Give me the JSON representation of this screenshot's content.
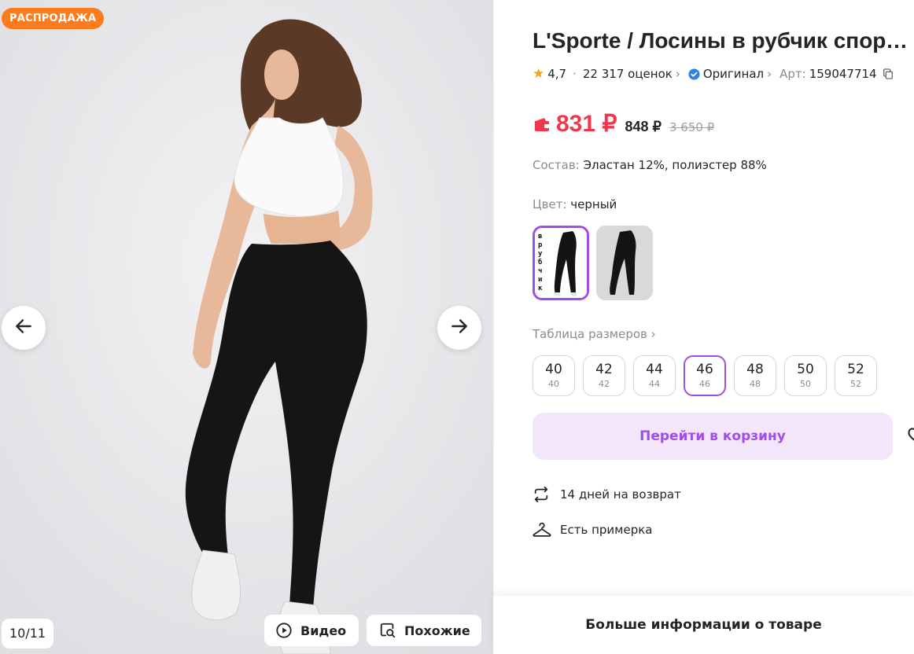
{
  "gallery": {
    "sale_badge": "РАСПРОДАЖА",
    "counter": "10/11",
    "video_label": "Видео",
    "similar_label": "Похожие",
    "prev_icon": "arrow-left-icon",
    "next_icon": "arrow-right-icon"
  },
  "product": {
    "title": "L'Sporte / Лосины в рубчик спортивные",
    "rating": "4,7",
    "reviews": "22 317 оценок",
    "original_label": "Оригинал",
    "article_label": "Арт:",
    "article": "159047714",
    "price_current": "831 ₽",
    "price_mid": "848 ₽",
    "price_old": "3 650 ₽",
    "composition_label": "Состав:",
    "composition": "Эластан 12%, полиэстер 88%",
    "color_label": "Цвет:",
    "color_value": "черный",
    "swatch_text": "в рубчик",
    "size_table_label": "Таблица размеров",
    "sizes": [
      {
        "main": "40",
        "sub": "40"
      },
      {
        "main": "42",
        "sub": "42"
      },
      {
        "main": "44",
        "sub": "44"
      },
      {
        "main": "46",
        "sub": "46"
      },
      {
        "main": "48",
        "sub": "48"
      },
      {
        "main": "50",
        "sub": "50"
      },
      {
        "main": "52",
        "sub": "52"
      }
    ],
    "selected_size": "46",
    "cart_button": "Перейти в корзину",
    "return_label": "14 дней на возврат",
    "fitting_label": "Есть примерка",
    "more_info": "Больше информации о товаре"
  },
  "colors": {
    "accent": "#a14dea",
    "price_red": "#f2374c",
    "sale_orange": "#ff7a1a",
    "cart_bg": "#f3e6fb",
    "star": "#ff9f1a",
    "verified_blue": "#2f7fe8"
  }
}
